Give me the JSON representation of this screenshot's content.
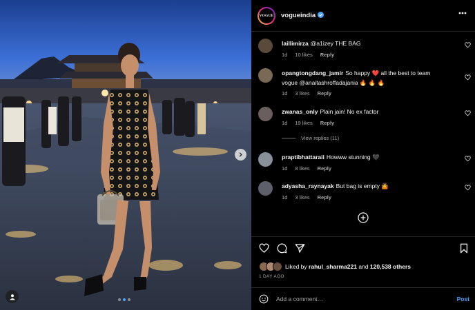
{
  "post": {
    "account": "vogueindia",
    "avatar_text": "VOGUE",
    "verified": true,
    "image_alt": "Woman in a black polka-dot dress holding a clear handbag at a palace courtyard at night",
    "carousel": {
      "count": 3,
      "active_index": 1
    }
  },
  "comments": [
    {
      "user": "laillimirza",
      "text": "@a1izey THE BAG",
      "time": "1d",
      "likes": "10 likes",
      "reply": "Reply",
      "avatar_color": "#5a4a3a"
    },
    {
      "user": "opangtongdang_jamir",
      "text": "So happy ❤️ all the best to team vogue @anaitashroffadajania 🔥 🔥 🔥",
      "time": "1d",
      "likes": "3 likes",
      "reply": "Reply",
      "avatar_color": "#7a6a55"
    },
    {
      "user": "zwanas_only",
      "text": "Plain jain! No ex factor",
      "time": "1d",
      "likes": "19 likes",
      "reply": "Reply",
      "avatar_color": "#6b5e5e",
      "view_replies": "View replies (11)"
    },
    {
      "user": "praptibhattaraii",
      "text": "Howww stunning 🖤",
      "time": "1d",
      "likes": "8 likes",
      "reply": "Reply",
      "avatar_color": "#8a8f99"
    },
    {
      "user": "adyasha_raynayak",
      "text": "But bag is empty 🤷",
      "time": "1d",
      "likes": "3 likes",
      "reply": "Reply",
      "avatar_color": "#5f5f6b"
    }
  ],
  "likes": {
    "prefix": "Liked by",
    "user": "rahul_sharma221",
    "middle": "and",
    "count": "120,538 others"
  },
  "date": "1 DAY AGO",
  "add_comment": {
    "placeholder": "Add a comment…",
    "post_label": "Post"
  },
  "colors": {
    "accent": "#4da3ff",
    "like_heart": "#ff3040",
    "background": "#000000",
    "divider": "#262626"
  }
}
